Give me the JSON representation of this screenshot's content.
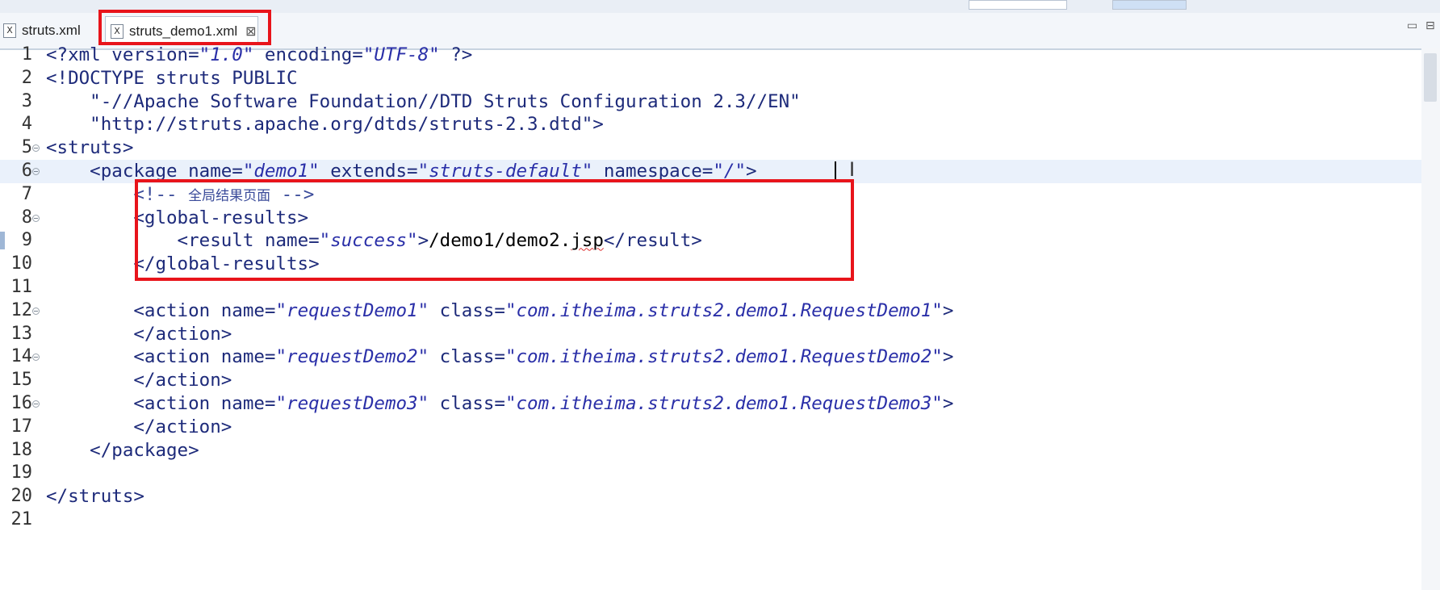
{
  "tabs": [
    {
      "label": "struts.xml",
      "icon": "xml-file-icon",
      "active": false
    },
    {
      "label": "struts_demo1.xml",
      "icon": "xml-file-icon",
      "active": true,
      "close": "⊠"
    }
  ],
  "window_buttons": {
    "minimize": "▭",
    "maximize": "⊟"
  },
  "editor": {
    "line_numbers": [
      "1",
      "2",
      "3",
      "4",
      "5",
      "6",
      "7",
      "8",
      "9",
      "10",
      "11",
      "12",
      "13",
      "14",
      "15",
      "16",
      "17",
      "18",
      "19",
      "20",
      "21"
    ],
    "line1": {
      "a": "<?xml version=",
      "b": "\"1.0\"",
      "c": " encoding=",
      "d": "\"UTF-8\"",
      "e": " ?>"
    },
    "line2": {
      "a": "<!DOCTYPE struts PUBLIC"
    },
    "line3": {
      "a": "    \"-//Apache Software Foundation//DTD Struts Configuration 2.3//EN\""
    },
    "line4": {
      "a": "    \"http://struts.apache.org/dtds/struts-2.3.dtd\">"
    },
    "line5": {
      "a": "<struts>"
    },
    "line6": {
      "a": "    <package ",
      "b": "name=",
      "c": "\"demo1\"",
      "d": " extends=",
      "e": "\"struts-default\"",
      "f": " namespace=",
      "g": "\"/\"",
      "h": ">"
    },
    "line7": {
      "a": "        <!-- ",
      "cn": "全局结果页面",
      "b": " -->"
    },
    "line8": {
      "a": "        <global-results>"
    },
    "line9": {
      "a": "            <result ",
      "b": "name=",
      "c": "\"success\"",
      "d": ">",
      "e": "/demo1/demo2.",
      "f": "jsp",
      "g": "</result>"
    },
    "line10": {
      "a": "        </global-results>"
    },
    "line12": {
      "a": "        <action ",
      "b": "name=",
      "c": "\"requestDemo1\"",
      "d": " class=",
      "e": "\"com.itheima.struts2.demo1.RequestDemo1\"",
      "f": ">"
    },
    "line13": {
      "a": "        </action>"
    },
    "line14": {
      "a": "        <action ",
      "b": "name=",
      "c": "\"requestDemo2\"",
      "d": " class=",
      "e": "\"com.itheima.struts2.demo1.RequestDemo2\"",
      "f": ">"
    },
    "line15": {
      "a": "        </action>"
    },
    "line16": {
      "a": "        <action ",
      "b": "name=",
      "c": "\"requestDemo3\"",
      "d": " class=",
      "e": "\"com.itheima.struts2.demo1.RequestDemo3\"",
      "f": ">"
    },
    "line17": {
      "a": "        </action>"
    },
    "line18": {
      "a": "    </package>"
    },
    "line20": {
      "a": "</struts>"
    }
  },
  "colors": {
    "highlight_box": "#e8141b",
    "current_line": "#eaf1fb",
    "tag": "#1d2a7a",
    "string": "#2a2fa8"
  }
}
